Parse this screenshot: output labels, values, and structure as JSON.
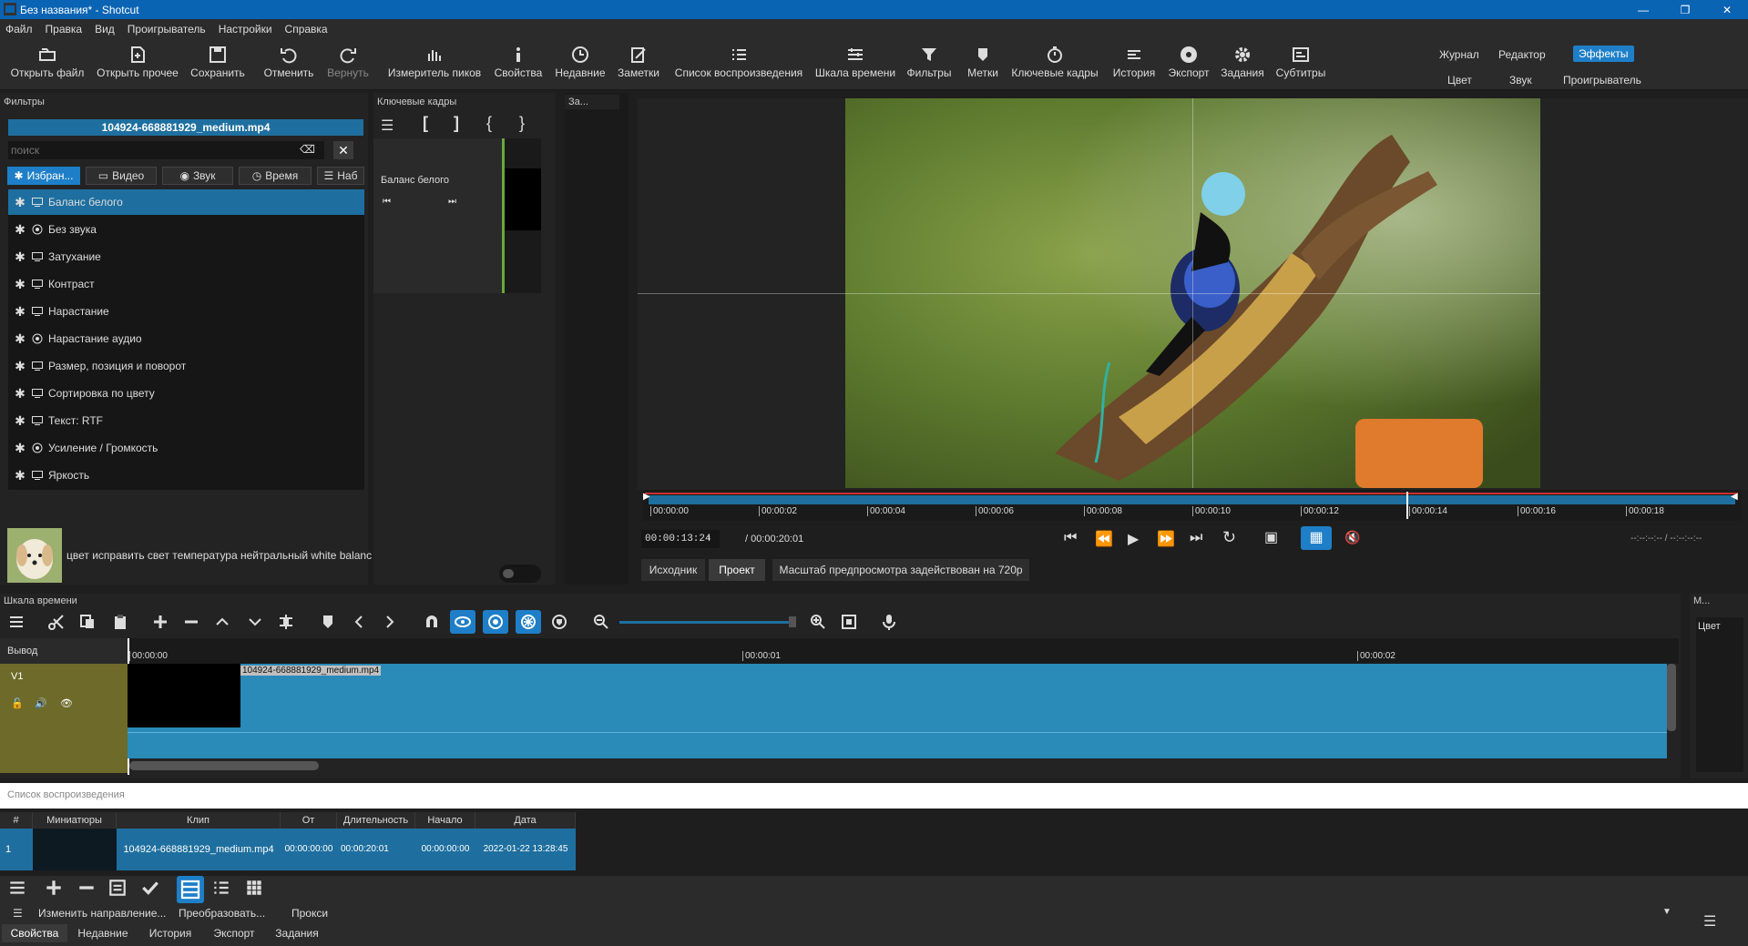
{
  "window": {
    "title": "Без названия* - Shotcut"
  },
  "menu": [
    "Файл",
    "Правка",
    "Вид",
    "Проигрыватель",
    "Настройки",
    "Справка"
  ],
  "toolbar": {
    "items": [
      {
        "label": "Открыть файл",
        "icon": "open-file-icon"
      },
      {
        "label": "Открыть прочее",
        "icon": "open-other-icon"
      },
      {
        "label": "Сохранить",
        "icon": "save-icon"
      },
      {
        "label": "Отменить",
        "icon": "undo-icon"
      },
      {
        "label": "Вернуть",
        "icon": "redo-icon"
      },
      {
        "label": "Измеритель пиков",
        "icon": "peak-meter-icon"
      },
      {
        "label": "Свойства",
        "icon": "info-icon"
      },
      {
        "label": "Недавние",
        "icon": "clock-icon"
      },
      {
        "label": "Заметки",
        "icon": "notes-icon"
      },
      {
        "label": "Список воспроизведения",
        "icon": "list-icon"
      },
      {
        "label": "Шкала времени",
        "icon": "timeline-icon"
      },
      {
        "label": "Фильтры",
        "icon": "filter-icon"
      },
      {
        "label": "Метки",
        "icon": "marker-icon"
      },
      {
        "label": "Ключевые кадры",
        "icon": "stopwatch-icon"
      },
      {
        "label": "История",
        "icon": "history-icon"
      },
      {
        "label": "Экспорт",
        "icon": "export-icon"
      },
      {
        "label": "Задания",
        "icon": "gear-icon"
      },
      {
        "label": "Субтитры",
        "icon": "subtitles-icon"
      }
    ],
    "layouts": {
      "journal": "Журнал",
      "editor": "Редактор",
      "effects": "Эффекты",
      "color": "Цвет",
      "audio": "Звук",
      "player": "Проигрыватель"
    }
  },
  "filters": {
    "title": "Фильтры",
    "clip_name": "104924-668881929_medium.mp4",
    "search_placeholder": "поиск",
    "tabs": [
      "Избран...",
      "Видео",
      "Звук",
      "Время",
      "Наб"
    ],
    "items": [
      {
        "label": "Баланс белого",
        "kind": "video"
      },
      {
        "label": "Без звука",
        "kind": "audio"
      },
      {
        "label": "Затухание",
        "kind": "video"
      },
      {
        "label": "Контраст",
        "kind": "video"
      },
      {
        "label": "Нарастание",
        "kind": "video"
      },
      {
        "label": "Нарастание аудио",
        "kind": "audio"
      },
      {
        "label": "Размер, позиция и поворот",
        "kind": "video"
      },
      {
        "label": "Сортировка по цвету",
        "kind": "video"
      },
      {
        "label": "Текст: RTF",
        "kind": "video"
      },
      {
        "label": "Усиление / Громкость",
        "kind": "audio"
      },
      {
        "label": "Яркость",
        "kind": "video"
      }
    ],
    "description": "цвет исправить свет температура нейтральный white balanc"
  },
  "keyframes": {
    "title": "Ключевые кадры",
    "track_label": "Баланс белого"
  },
  "notes": {
    "title": "За..."
  },
  "player": {
    "ruler": [
      "00:00:00",
      "00:00:02",
      "00:00:04",
      "00:00:06",
      "00:00:08",
      "00:00:10",
      "00:00:12",
      "00:00:14",
      "00:00:16",
      "00:00:18"
    ],
    "position": "00:00:13:24",
    "duration": "/ 00:00:20:01",
    "in_out": "--:--:--:-- / --:--:--:--",
    "tab_source": "Исходник",
    "tab_project": "Проект",
    "preview_note": "Масштаб предпросмотра задействован на 720p"
  },
  "timeline": {
    "title": "Шкала времени",
    "output_label": "Вывод",
    "track_name": "V1",
    "ruler": [
      "00:00:00",
      "00:00:01",
      "00:00:02"
    ],
    "clip_name": "104924-668881929_medium.mp4"
  },
  "markers_panel": {
    "title": "М...",
    "color_label": "Цвет"
  },
  "playlist": {
    "title": "Список воспроизведения",
    "columns": [
      "#",
      "Миниатюры",
      "Клип",
      "От",
      "Длительность",
      "Начало",
      "Дата"
    ],
    "rows": [
      {
        "num": "1",
        "clip": "104924-668881929_medium.mp4",
        "from": "00:00:00:00",
        "duration": "00:00:20:01",
        "start": "00:00:00:00",
        "date": "2022-01-22 13:28:45"
      }
    ],
    "actions": [
      "Изменить направление...",
      "Преобразовать...",
      "Прокси"
    ]
  },
  "bottom_tabs": [
    "Свойства",
    "Недавние",
    "История",
    "Экспорт",
    "Задания"
  ],
  "colors": {
    "accent": "#1e7fc8",
    "titlebar": "#0a64b4",
    "track": "#2a8ab8",
    "track_header": "#6e6a2a"
  }
}
